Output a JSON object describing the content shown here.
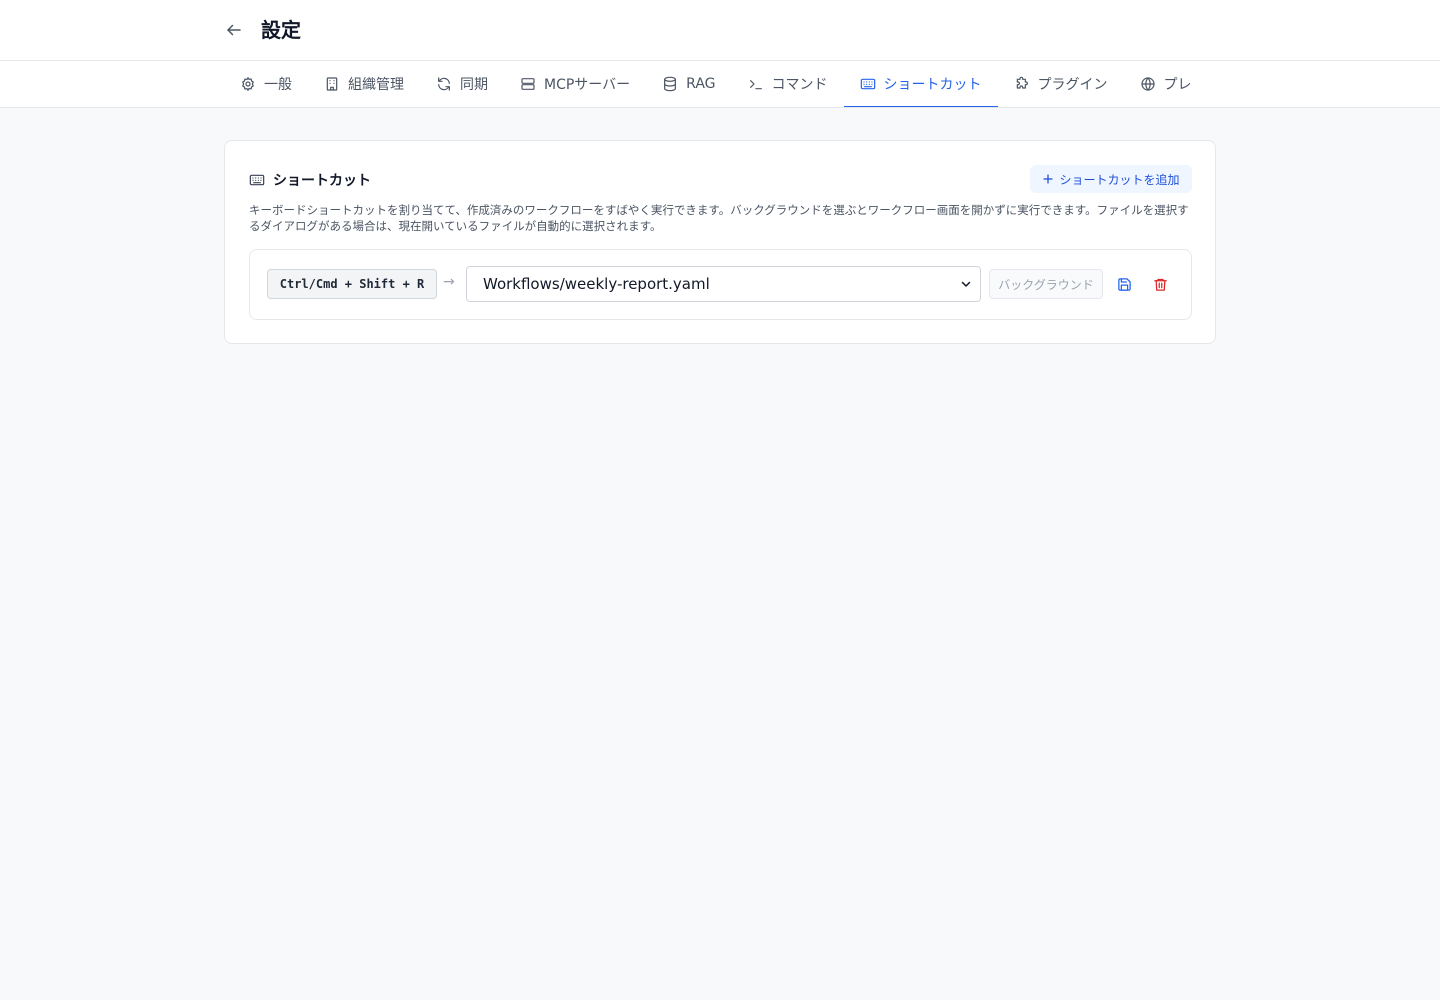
{
  "header": {
    "title": "設定",
    "back_icon": "arrow-left-icon"
  },
  "tabs": [
    {
      "label": "一般",
      "icon": "gear-icon",
      "active": false
    },
    {
      "label": "組織管理",
      "icon": "building-icon",
      "active": false
    },
    {
      "label": "同期",
      "icon": "refresh-icon",
      "active": false
    },
    {
      "label": "MCPサーバー",
      "icon": "server-icon",
      "active": false
    },
    {
      "label": "RAG",
      "icon": "database-icon",
      "active": false
    },
    {
      "label": "コマンド",
      "icon": "terminal-icon",
      "active": false
    },
    {
      "label": "ショートカット",
      "icon": "keyboard-icon",
      "active": true
    },
    {
      "label": "プラグイン",
      "icon": "puzzle-icon",
      "active": false
    },
    {
      "label": "プレ",
      "icon": "globe-icon",
      "active": false
    }
  ],
  "shortcuts_section": {
    "title": "ショートカット",
    "title_icon": "keyboard-icon",
    "add_button_label": "ショートカットを追加",
    "description": "キーボードショートカットを割り当てて、作成済みのワークフローをすばやく実行できます。バックグラウンドを選ぶとワークフロー画面を開かずに実行できます。ファイルを選択するダイアログがある場合は、現在開いているファイルが自動的に選択されます。",
    "items": [
      {
        "keys": "Ctrl/Cmd + Shift + R",
        "arrow": "→",
        "workflow": "Workflows/weekly-report.yaml",
        "background_label": "バックグラウンド",
        "background_enabled": false
      }
    ]
  },
  "colors": {
    "accent": "#2563eb",
    "danger": "#dc2626",
    "muted_text": "#4b5563",
    "border": "#e5e7eb",
    "page_bg": "#f8f9fb"
  }
}
